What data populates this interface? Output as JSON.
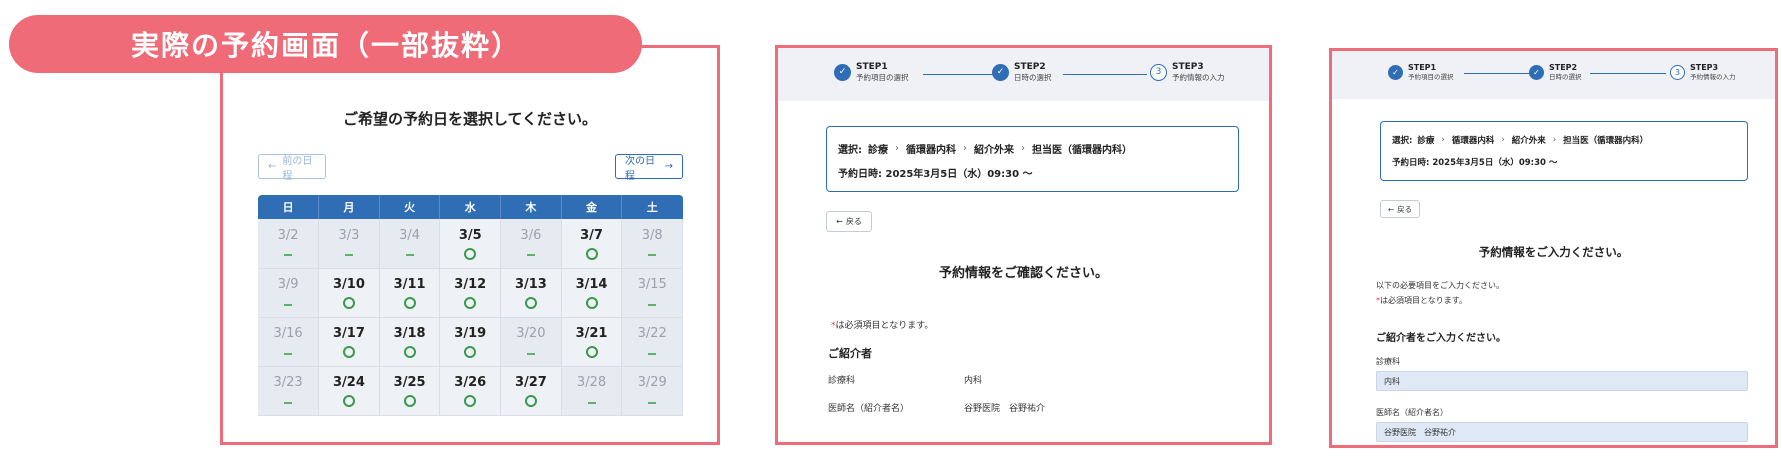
{
  "banner": {
    "text": "実際の予約画面（一部抜粋）"
  },
  "calendar_panel": {
    "title": "ご希望の予約日を選択してください。",
    "prev_label": "前の日程",
    "next_label": "次の日程",
    "weekdays": [
      "日",
      "月",
      "火",
      "水",
      "木",
      "金",
      "土"
    ],
    "weeks": [
      [
        {
          "date": "3/2",
          "status": "unavailable"
        },
        {
          "date": "3/3",
          "status": "unavailable"
        },
        {
          "date": "3/4",
          "status": "unavailable"
        },
        {
          "date": "3/5",
          "status": "available"
        },
        {
          "date": "3/6",
          "status": "unavailable"
        },
        {
          "date": "3/7",
          "status": "available"
        },
        {
          "date": "3/8",
          "status": "unavailable"
        }
      ],
      [
        {
          "date": "3/9",
          "status": "unavailable"
        },
        {
          "date": "3/10",
          "status": "available"
        },
        {
          "date": "3/11",
          "status": "available"
        },
        {
          "date": "3/12",
          "status": "available"
        },
        {
          "date": "3/13",
          "status": "available"
        },
        {
          "date": "3/14",
          "status": "available"
        },
        {
          "date": "3/15",
          "status": "unavailable"
        }
      ],
      [
        {
          "date": "3/16",
          "status": "unavailable"
        },
        {
          "date": "3/17",
          "status": "available"
        },
        {
          "date": "3/18",
          "status": "available"
        },
        {
          "date": "3/19",
          "status": "available"
        },
        {
          "date": "3/20",
          "status": "unavailable"
        },
        {
          "date": "3/21",
          "status": "available"
        },
        {
          "date": "3/22",
          "status": "unavailable"
        }
      ],
      [
        {
          "date": "3/23",
          "status": "unavailable"
        },
        {
          "date": "3/24",
          "status": "available"
        },
        {
          "date": "3/25",
          "status": "available"
        },
        {
          "date": "3/26",
          "status": "available"
        },
        {
          "date": "3/27",
          "status": "available"
        },
        {
          "date": "3/28",
          "status": "unavailable"
        },
        {
          "date": "3/29",
          "status": "unavailable"
        }
      ]
    ]
  },
  "steps": [
    {
      "label": "STEP1",
      "sub": "予約項目の選択",
      "number": "1",
      "state": "done"
    },
    {
      "label": "STEP2",
      "sub": "日時の選択",
      "number": "2",
      "state": "done"
    },
    {
      "label": "STEP3",
      "sub": "予約情報の入力",
      "number": "3",
      "state": "current"
    }
  ],
  "selection": {
    "prefix": "選択:",
    "crumbs": [
      "診療",
      "循環器内科",
      "紹介外来",
      "担当医（循環器内科）"
    ],
    "datetime": "予約日時: 2025年3月5日（水）09:30 ～"
  },
  "back_label": "戻る",
  "confirm_panel": {
    "title": "予約情報をご確認ください。",
    "required_note": "は必須項目となります。",
    "section": "ご紹介者",
    "rows": [
      {
        "label": "診療科",
        "value": "内科"
      },
      {
        "label": "医師名（紹介者名）",
        "value": "谷野医院　谷野祐介"
      }
    ]
  },
  "input_panel": {
    "title": "予約情報をご入力ください。",
    "intro": "以下の必要項目をご入力ください。",
    "required_note": "は必須項目となります。",
    "section": "ご紹介者をご入力ください。",
    "fields": [
      {
        "label": "診療科",
        "value": "内科"
      },
      {
        "label": "医師名（紹介者名）",
        "value": "谷野医院　谷野祐介"
      }
    ]
  },
  "icons": {
    "check": "check-icon",
    "arrow_left": "arrow-left-icon",
    "arrow_right": "arrow-right-icon",
    "chevron": "chevron-right-icon"
  },
  "colors": {
    "accent": "#2f6db4",
    "banner": "#f06b78",
    "frame": "#ef6d7a",
    "available": "#3a9a4b",
    "required": "#e0394b"
  }
}
